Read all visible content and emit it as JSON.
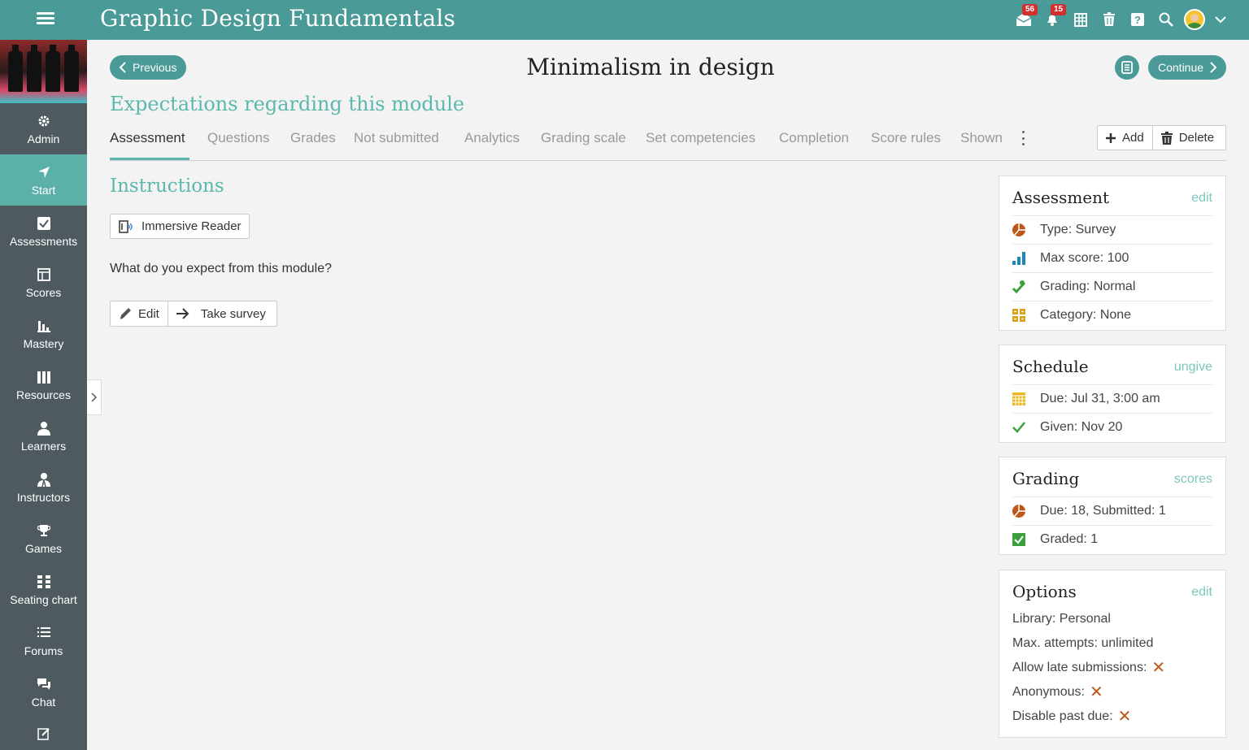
{
  "header": {
    "course_title": "Graphic Design Fundamentals",
    "messages_badge": "56",
    "notifications_badge": "15"
  },
  "sidebar": {
    "items": [
      {
        "label": "Admin",
        "icon": "gear-icon"
      },
      {
        "label": "Start",
        "icon": "navigation-arrow-icon"
      },
      {
        "label": "Assessments",
        "icon": "checkbox-icon"
      },
      {
        "label": "Scores",
        "icon": "gradebook-icon"
      },
      {
        "label": "Mastery",
        "icon": "bar-chart-icon"
      },
      {
        "label": "Resources",
        "icon": "books-icon"
      },
      {
        "label": "Learners",
        "icon": "person-icon"
      },
      {
        "label": "Instructors",
        "icon": "instructor-icon"
      },
      {
        "label": "Games",
        "icon": "trophy-icon"
      },
      {
        "label": "Seating chart",
        "icon": "seating-grid-icon"
      },
      {
        "label": "Forums",
        "icon": "list-icon"
      },
      {
        "label": "Chat",
        "icon": "chat-bubbles-icon"
      }
    ]
  },
  "page": {
    "previous_label": "Previous",
    "continue_label": "Continue",
    "title": "Minimalism in design",
    "module_title": "Expectations regarding this module"
  },
  "tabs": [
    "Assessment",
    "Questions",
    "Grades",
    "Not submitted",
    "Analytics",
    "Grading scale",
    "Set competencies",
    "Completion",
    "Score rules",
    "Shown"
  ],
  "toolbar": {
    "add_label": "Add",
    "delete_label": "Delete"
  },
  "content": {
    "instructions_heading": "Instructions",
    "reader_label": "Immersive Reader",
    "question": "What do you expect from this module?",
    "edit_label": "Edit",
    "take_survey_label": "Take survey"
  },
  "assessment_panel": {
    "title": "Assessment",
    "link": "edit",
    "type": "Type: Survey",
    "max_score": "Max score: 100",
    "grading": "Grading: Normal",
    "category": "Category: None"
  },
  "schedule_panel": {
    "title": "Schedule",
    "link": "ungive",
    "due": "Due: Jul 31, 3:00 am",
    "given": "Given: Nov 20"
  },
  "grading_panel": {
    "title": "Grading",
    "link": "scores",
    "due_submitted": "Due: 18, Submitted: 1",
    "graded": "Graded: 1"
  },
  "options_panel": {
    "title": "Options",
    "link": "edit",
    "library": "Library: Personal",
    "max_attempts": "Max. attempts: unlimited",
    "late": "Allow late submissions:",
    "anonymous": "Anonymous:",
    "disable_past_due": "Disable past due:"
  },
  "colors": {
    "brand": "#4a9a97",
    "accent": "#5bb8ad",
    "sidebar": "#4e5a5f",
    "x_mark": "#c0571a"
  }
}
